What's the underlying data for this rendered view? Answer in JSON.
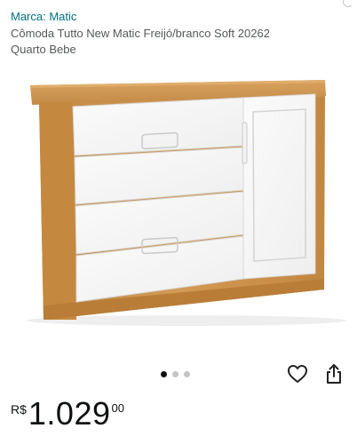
{
  "header": {
    "brand_link": "Marca: Matic",
    "title_line1": "Cômoda Tutto New Matic Freijó/branco Soft 20262",
    "title_line2": "Quarto Bebe"
  },
  "gallery": {
    "image_subject": "Cômoda com 3 gavetas e 1 porta, tampo freijó e frentes brancas",
    "image_count": 3,
    "active_index": 0
  },
  "actions": {
    "favorite_icon": "heart-outline-icon",
    "share_icon": "share-icon"
  },
  "price": {
    "currency": "R$",
    "whole": "1.029",
    "fraction": "00"
  },
  "colors": {
    "brand_link": "#007185",
    "wood": "#c98f4b",
    "panel_white": "#f4f4f4"
  }
}
